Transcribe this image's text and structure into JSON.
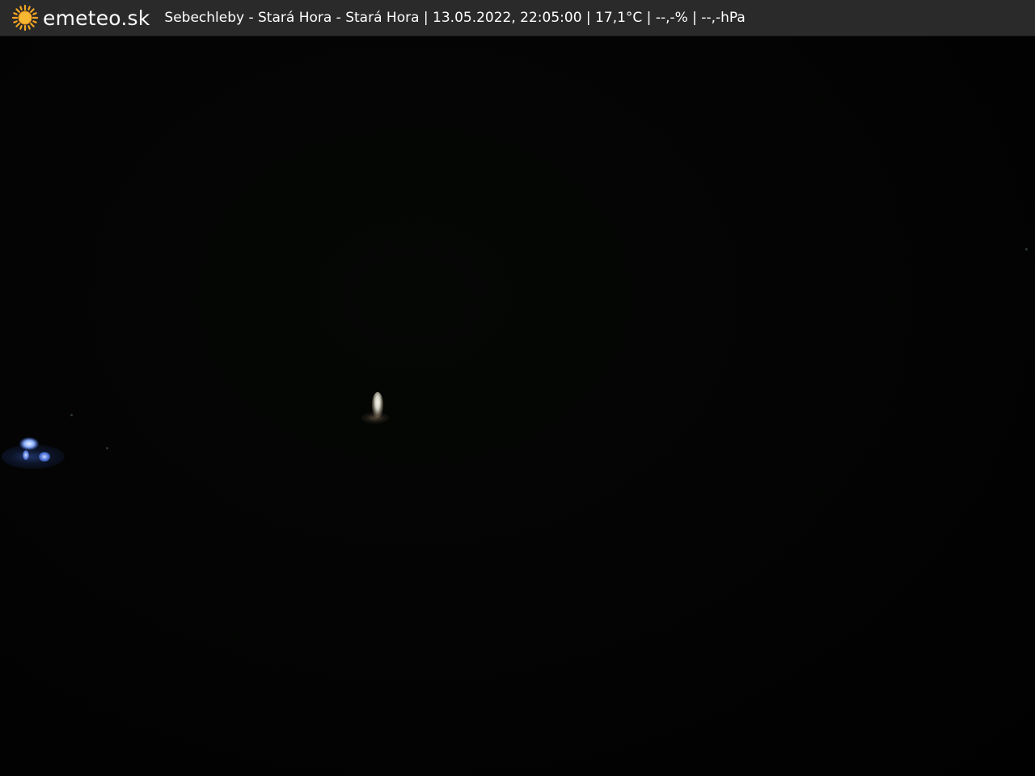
{
  "header": {
    "brand": "emeteo.sk",
    "caption": "Sebechleby - Stará Hora - Stará Hora | 13.05.2022, 22:05:00 | 17,1°C | --,-% | --,-hPa",
    "logo_icon": "sun-icon",
    "background_color": "#2a2a2a",
    "text_color": "#ffffff",
    "sun_color": "#f5a623"
  },
  "scene": {
    "background_color": "#020302"
  }
}
